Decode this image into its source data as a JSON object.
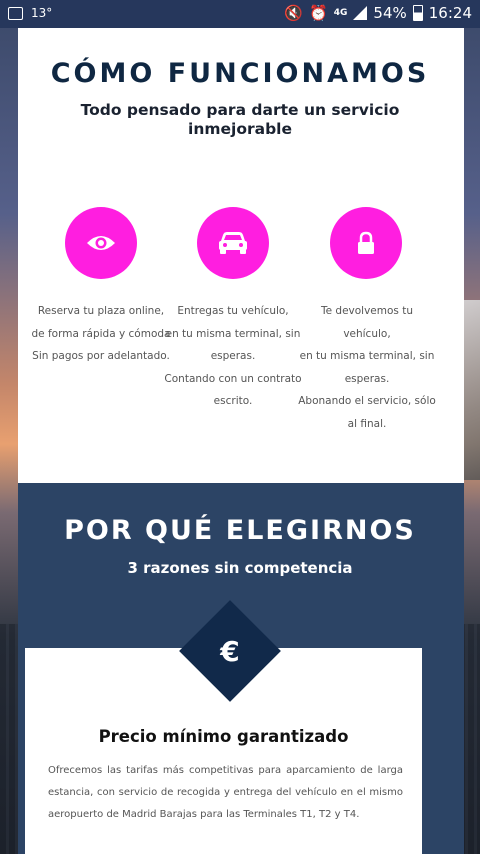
{
  "status_bar": {
    "temperature": "13°",
    "network": "4G",
    "battery": "54%",
    "time": "16:24"
  },
  "how_it_works": {
    "title": "CÓMO FUNCIONAMOS",
    "subtitle": "Todo pensado para darte un servicio inmejorable",
    "accent_color": "#ff1ee0",
    "features": [
      {
        "icon": "eye-icon",
        "lines": [
          "Reserva tu plaza online,",
          "de forma rápida y cómoda",
          "Sin pagos por adelantado."
        ]
      },
      {
        "icon": "car-icon",
        "lines": [
          "Entregas tu vehículo,",
          "en tu misma terminal, sin",
          "esperas.",
          "Contando con un contrato",
          "escrito."
        ]
      },
      {
        "icon": "lock-icon",
        "lines": [
          "Te devolvemos tu",
          "vehículo,",
          "en tu misma terminal, sin",
          "esperas.",
          "Abonando el servicio, sólo",
          "al final."
        ]
      }
    ]
  },
  "why_us": {
    "title": "POR QUÉ ELEGIRNOS",
    "subtitle": "3 razones sin competencia",
    "card": {
      "icon_symbol": "€",
      "title": "Precio mínimo garantizado",
      "body": "Ofrecemos las tarifas más competitivas para aparcamiento de larga estancia, con servicio de recogida y entrega del vehículo en el mismo aeropuerto de Madrid Barajas para las Terminales T1, T2 y T4."
    }
  }
}
